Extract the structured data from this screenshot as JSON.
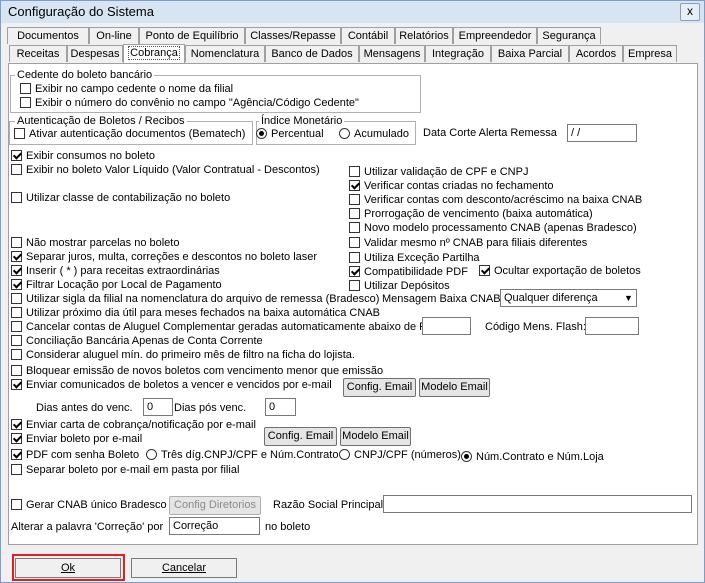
{
  "window": {
    "title": "Configuração do Sistema",
    "close_glyph": "x"
  },
  "tabs_row1": [
    "Documentos",
    "On-line",
    "Ponto de Equilíbrio",
    "Classes/Repasse",
    "Contábil",
    "Relatórios",
    "Empreendedor",
    "Segurança"
  ],
  "tabs_row2": [
    "Receitas",
    "Despesas",
    "Cobrança",
    "Nomenclatura",
    "Banco de Dados",
    "Mensagens",
    "Integração",
    "Baixa Parcial",
    "Acordos",
    "Empresa"
  ],
  "active_tab": "Cobrança",
  "cedente": {
    "legend": "Cedente do boleto bancário",
    "opt1": "Exibir no campo cedente o nome da filial",
    "opt2": "Exibir o número do convênio no campo \"Agência/Código Cedente\""
  },
  "autenticacao": {
    "legend": "Autenticação de Boletos / Recibos",
    "opt": "Ativar autenticação documentos (Bematech)"
  },
  "indice": {
    "legend": "Índice Monetário",
    "percentual": "Percentual",
    "acumulado": "Acumulado"
  },
  "data_corte": {
    "label": "Data Corte Alerta Remessa",
    "value": " / /"
  },
  "left_options": {
    "exibir_consumos": "Exibir consumos no boleto",
    "valor_liquido": "Exibir no boleto Valor Líquido (Valor Contratual - Descontos)",
    "classe_contab": "Utilizar classe de contabilização no boleto",
    "nao_mostrar": "Não mostrar parcelas no boleto",
    "separar_juros": "Separar juros, multa, correções e descontos no boleto laser",
    "inserir": "Inserir ( * ) para receitas extraordinárias",
    "filtrar": "Filtrar Locação por Local de Pagamento",
    "sigla": "Utilizar sigla da filial na nomenclatura do arquivo de remessa (Bradesco)",
    "proximo_dia": "Utilizar próximo dia útil para meses fechados na baixa automática CNAB",
    "cancelar_contas": "Cancelar contas de Aluguel Complementar geradas automaticamente abaixo de R$",
    "conciliacao": "Conciliação Bancária Apenas de Conta Corrente",
    "considerar": "Considerar aluguel mín. do primeiro mês de filtro na ficha do lojista.",
    "bloquear": "Bloquear emissão de novos boletos com vencimento menor que emissão",
    "enviar_comunicados": "Enviar comunicados de boletos a vencer e vencidos por e-mail",
    "enviar_carta": "Enviar carta de cobrança/notificação por e-mail",
    "enviar_boleto": "Enviar boleto por e-mail",
    "pdf_senha": "PDF com senha Boleto",
    "separar_boleto": "Separar boleto por e-mail em pasta por filial",
    "gerar_cnab": "Gerar CNAB único Bradesco"
  },
  "right_options": {
    "validacao": "Utilizar validação de CPF e CNPJ",
    "verificar_contas": "Verificar contas criadas no fechamento",
    "verificar_desconto": "Verificar contas com desconto/acréscimo na baixa CNAB",
    "prorrogacao": "Prorrogação de vencimento (baixa automática)",
    "novo_modelo": "Novo modelo processamento CNAB (apenas Bradesco)",
    "validar_mesmo": "Validar mesmo nº CNAB para filiais diferentes",
    "excecao": "Utiliza Exceção Partilha",
    "compat_pdf": "Compatibilidade PDF",
    "ocultar": "Ocultar exportação de boletos",
    "depositos": "Utilizar Depósitos"
  },
  "mensagem_baixa": {
    "label": "Mensagem Baixa CNAB:",
    "value": "Qualquer diferença"
  },
  "codigo_flash": {
    "label": "Código Mens. Flash:",
    "value": ""
  },
  "cancelar_valor": "",
  "buttons": {
    "config_email": "Config. Email",
    "modelo_email": "Modelo Email",
    "config_diretorios": "Config Diretorios"
  },
  "dias": {
    "antes_label": "Dias antes do venc.",
    "antes_value": "0",
    "pos_label": "Dias pós venc.",
    "pos_value": "0"
  },
  "pdf_radios": {
    "r1": "Três díg.CNPJ/CPF e Núm.Contrato",
    "r2": "CNPJ/CPF (números)",
    "r3": "Núm.Contrato e Núm.Loja"
  },
  "razao_social": {
    "label": "Razão Social Principal",
    "value": ""
  },
  "alterar": {
    "label": "Alterar a palavra 'Correção' por",
    "value": "Correção",
    "suffix": "no boleto"
  },
  "footer": {
    "ok": "Ok",
    "cancelar": "Cancelar"
  }
}
